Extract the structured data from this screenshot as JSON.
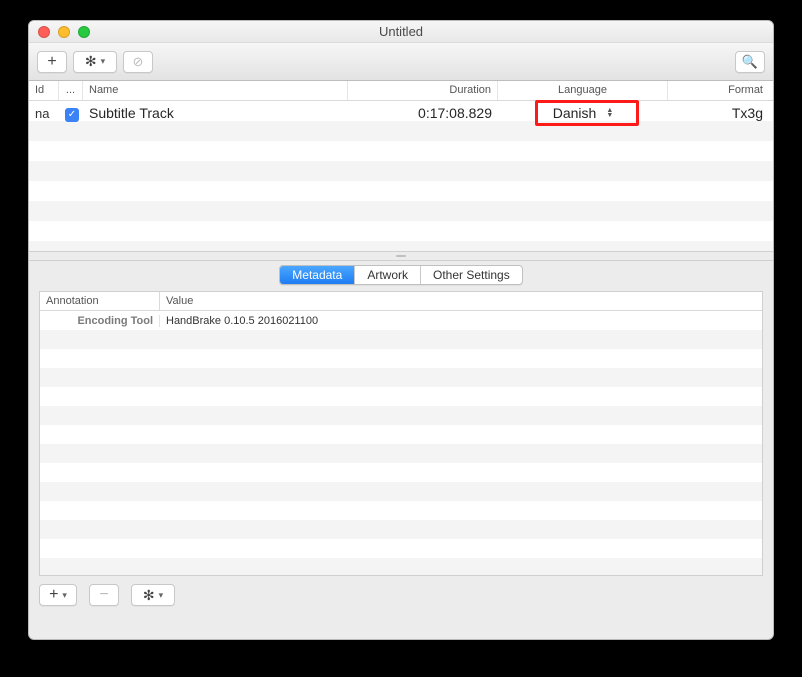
{
  "window": {
    "title": "Untitled"
  },
  "toolbar": {
    "add_label": "+",
    "gear_label": "✻",
    "disabled_label": "⊘",
    "search_label": "🔍"
  },
  "tracks": {
    "headers": {
      "id": "Id",
      "enabled": "...",
      "name": "Name",
      "duration": "Duration",
      "language": "Language",
      "format": "Format"
    },
    "rows": [
      {
        "id": "na",
        "enabled": true,
        "name": "Subtitle Track",
        "duration": "0:17:08.829",
        "language": "Danish",
        "format": "Tx3g"
      }
    ]
  },
  "tabs": {
    "metadata": "Metadata",
    "artwork": "Artwork",
    "other": "Other Settings",
    "active": "metadata"
  },
  "metadata": {
    "headers": {
      "annotation": "Annotation",
      "value": "Value"
    },
    "rows": [
      {
        "annotation": "Encoding Tool",
        "value": "HandBrake 0.10.5 2016021100"
      }
    ]
  },
  "bottom": {
    "add": "+",
    "remove": "−",
    "gear": "✻"
  }
}
